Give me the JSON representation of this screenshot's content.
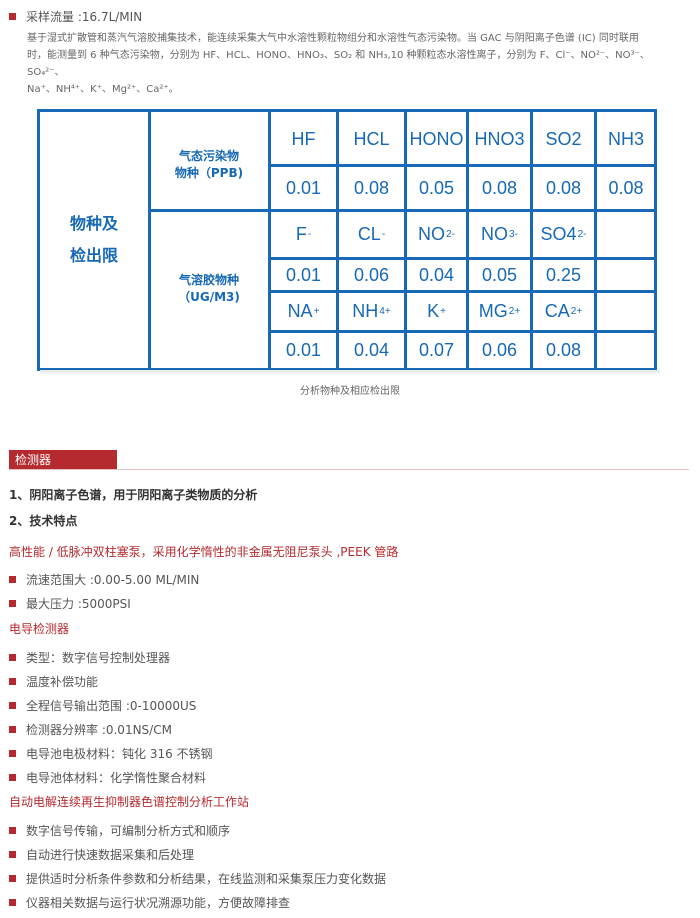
{
  "intro": {
    "sample_flow": "采样流量 :16.7L/MIN",
    "para_line1": "基于湿式扩散管和蒸汽气溶胶捕集技术，能连续采集大气中水溶性颗粒物组分和水溶性气态污染物。当 GAC 与阴阳离子色谱 (IC) 同时联用",
    "para_line2": "时，能测量到 6 种气态污染物，分别为 HF、HCL、HONO、HNO₃、SO₂ 和 NH₃,10 种颗粒态水溶性离子，分别为 F、Cl⁻、NO²⁻、NO³⁻、SO₄²⁻、",
    "para_line3": "Na⁺、NH⁴⁺、K⁺、Mg²⁺、Ca²⁺。"
  },
  "table": {
    "row_header": "物种及\n检出限",
    "gas_label_l1": "气态污染物",
    "gas_label_l2": "物种（PPB)",
    "aerosol_label_l1": "气溶胶物种",
    "aerosol_label_l2": "（UG/M3)",
    "gas_species": [
      "HF",
      "HCL",
      "HONO",
      "HNO3",
      "SO2",
      "NH3"
    ],
    "gas_values": [
      "0.01",
      "0.08",
      "0.05",
      "0.08",
      "0.08",
      "0.08"
    ],
    "anion_names": [
      "F",
      "CL",
      "NO",
      "NO",
      "SO4"
    ],
    "anion_sups": [
      "-",
      "-",
      "2-",
      "3-",
      "2-"
    ],
    "anion_values": [
      "0.01",
      "0.06",
      "0.04",
      "0.05",
      "0.25"
    ],
    "cation_names": [
      "NA",
      "NH",
      "K",
      "MG",
      "CA"
    ],
    "cation_sups": [
      "+",
      "4+",
      "+",
      "2+",
      "2+"
    ],
    "cation_values": [
      "0.01",
      "0.04",
      "0.07",
      "0.06",
      "0.08"
    ],
    "caption": "分析物种及相应检出限"
  },
  "detector": {
    "section_title": "检测器",
    "heading1": "1、阴阳离子色谱，用于阴阳离子类物质的分析",
    "heading2": "2、技术特点",
    "pump_title": "高性能 / 低脉冲双柱塞泵，采用化学惰性的非金属无阻尼泵头 ,PEEK 管路",
    "pump_items": [
      "流速范围大 :0.00-5.00 ML/MIN",
      "最大压力 :5000PSI"
    ],
    "cond_title": "电导检测器",
    "cond_items": [
      "类型：数字信号控制处理器",
      "温度补偿功能",
      "全程信号输出范围 :0-10000US",
      "检测器分辨率 :0.01NS/CM",
      "电导池电极材料：钝化 316 不锈钢",
      "电导池体材料：化学惰性聚合材料"
    ],
    "station_title": "自动电解连续再生抑制器色谱控制分析工作站",
    "station_items": [
      "数字信号传输，可编制分析方式和顺序",
      "自动进行快速数据采集和后处理",
      "提供适时分析条件参数和分析结果，在线监测和采集泵压力变化数据",
      "仪器相关数据与运行状况溯源功能，方便故障排查"
    ]
  },
  "colors": {
    "accent_red": "#b52a2e",
    "table_blue": "#1769b5"
  }
}
